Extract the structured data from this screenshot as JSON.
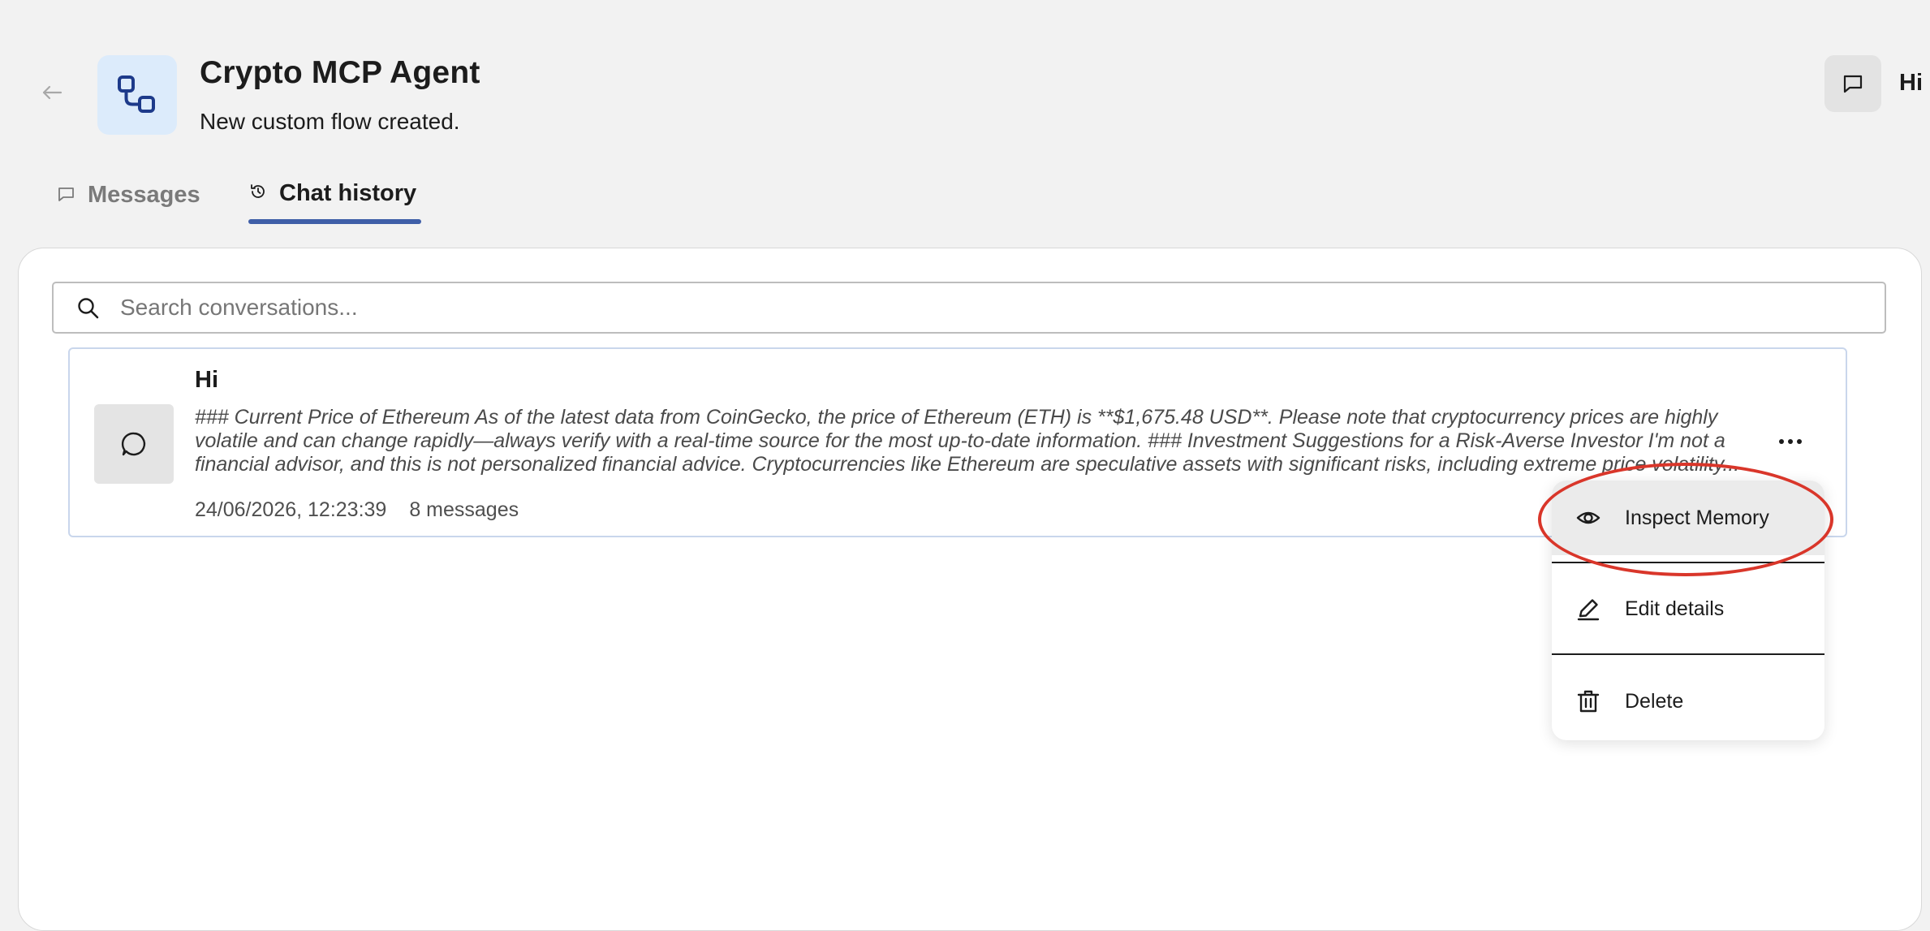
{
  "header": {
    "title": "Crypto MCP Agent",
    "subtitle": "New custom flow created.",
    "right_label": "Hi"
  },
  "tabs": [
    {
      "label": "Messages",
      "icon": "chat-bubble-icon",
      "active": false
    },
    {
      "label": "Chat history",
      "icon": "history-icon",
      "active": true
    }
  ],
  "search": {
    "placeholder": "Search conversations...",
    "value": ""
  },
  "conversation": {
    "title": "Hi",
    "preview": "### Current Price of Ethereum As of the latest data from CoinGecko, the price of Ethereum (ETH) is **$1,675.48 USD**. Please note that cryptocurrency prices are highly volatile and can change rapidly—always verify with a real-time source for the most up-to-date information. ### Investment Suggestions for a Risk-Averse Investor I'm not a financial advisor, and this is not personalized financial advice. Cryptocurrencies like Ethereum are speculative assets with significant risks, including extreme price volatility...",
    "timestamp": "24/06/2026, 12:23:39",
    "message_count": "8 messages"
  },
  "context_menu": {
    "items": [
      {
        "label": "Inspect Memory",
        "icon": "eye-icon"
      },
      {
        "label": "Edit details",
        "icon": "pencil-icon"
      },
      {
        "label": "Delete",
        "icon": "trash-icon"
      }
    ]
  },
  "colors": {
    "accent": "#3f5fa8",
    "agent_icon_bg": "#dcebfb",
    "highlight": "#d9362a"
  }
}
